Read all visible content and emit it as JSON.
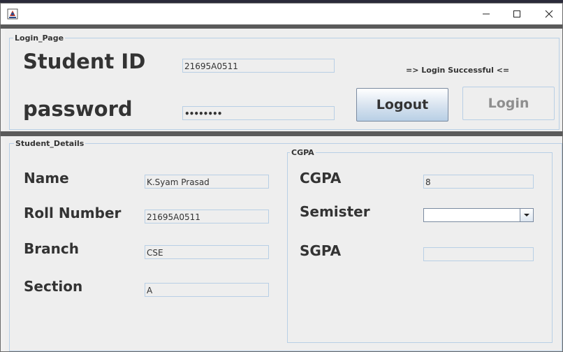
{
  "window": {
    "icon": "java-app-icon",
    "controls": [
      "minimize-icon",
      "maximize-icon",
      "close-icon"
    ]
  },
  "login_page": {
    "group_title": "Login_Page",
    "student_id_label": "Student ID",
    "student_id_value": "21695A0511",
    "password_label": "password",
    "password_value": "••••••••",
    "status_text": "=> Login Successful <=",
    "logout_label": "Logout",
    "login_label": "Login"
  },
  "student_details": {
    "group_title": "Student_Details",
    "name_label": "Name",
    "name_value": "K.Syam Prasad",
    "roll_label": "Roll Number",
    "roll_value": "21695A0511",
    "branch_label": "Branch",
    "branch_value": "CSE",
    "section_label": "Section",
    "section_value": "A"
  },
  "cgpa": {
    "group_title": "CGPA",
    "cgpa_label": "CGPA",
    "cgpa_value": "8",
    "semester_label": "Semister",
    "semester_value": "",
    "sgpa_label": "SGPA",
    "sgpa_value": ""
  }
}
